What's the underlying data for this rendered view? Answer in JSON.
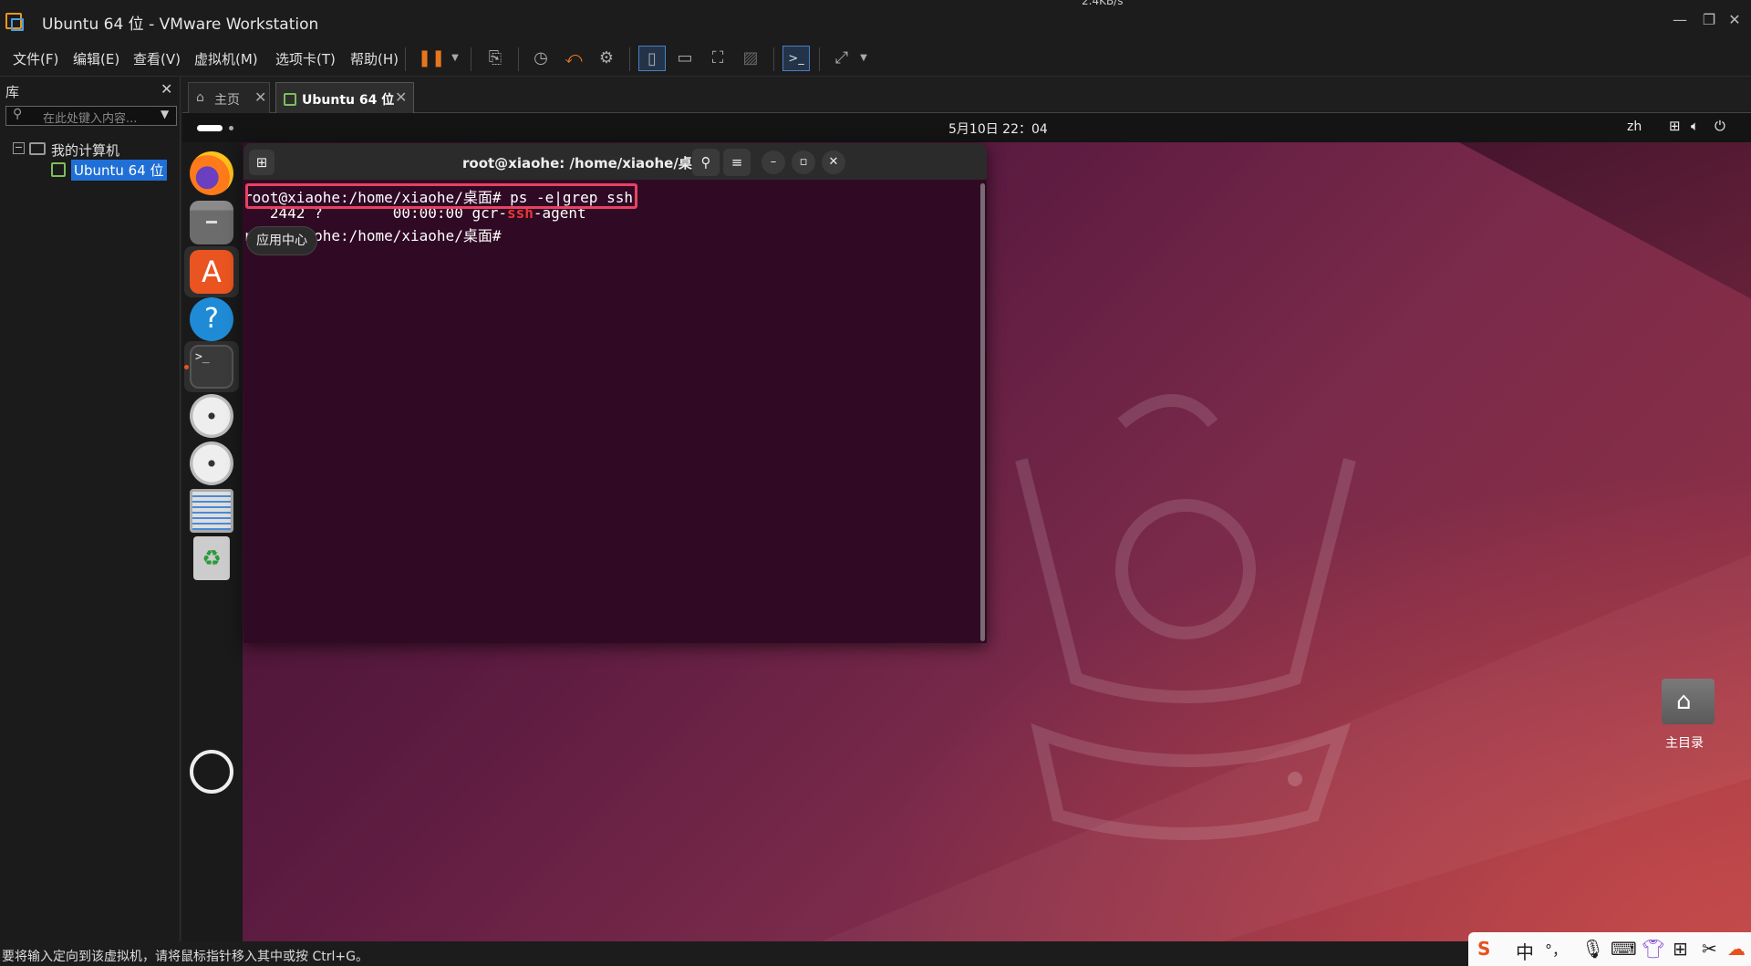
{
  "window": {
    "title": "Ubuntu 64 位 - VMware Workstation",
    "net_speed": "2.4KB/s"
  },
  "menu": [
    "文件(F)",
    "编辑(E)",
    "查看(V)",
    "虚拟机(M)",
    "选项卡(T)",
    "帮助(H)"
  ],
  "library": {
    "title": "库",
    "search_placeholder": "在此处键入内容...",
    "root": "我的计算机",
    "vm": "Ubuntu 64 位"
  },
  "tabs": [
    {
      "label": "主页"
    },
    {
      "label": "Ubuntu 64 位"
    }
  ],
  "ubuntu": {
    "clock": "5月10日 22：04",
    "input_lang": "zh",
    "terminal": {
      "title": "root@xiaohe: /home/xiaohe/桌面",
      "line1_prompt": "root@xiaohe:/home/xiaohe/桌面#",
      "line1_cmd": " ps -e|grep ssh",
      "line2_a": "   2442 ?        00:00:00 gcr-",
      "line2_match": "ssh",
      "line2_b": "-agent",
      "line3_prompt": "root@xiaohe:/home/xiaohe/桌面#"
    },
    "tooltip": "应用中心",
    "desktop_home": "主目录"
  },
  "status": "要将输入定向到该虚拟机，请将鼠标指针移入其中或按 Ctrl+G。",
  "ime": {
    "mode": "中",
    "punct": "°，"
  },
  "colors": {
    "terminal_bg": "#300a24",
    "highlight": "#e84262",
    "grep_match": "#e53935",
    "selection": "#1f6fd6"
  }
}
